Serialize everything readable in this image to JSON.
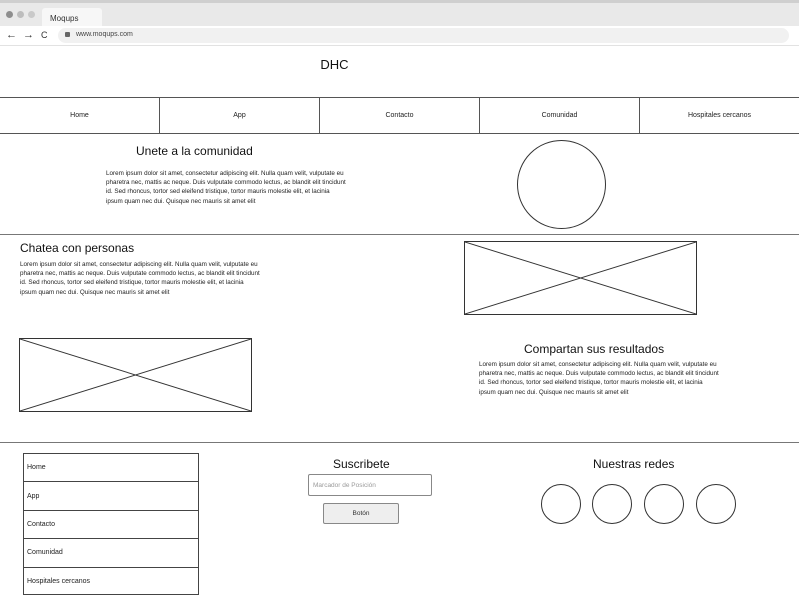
{
  "browser": {
    "tab_title": "Moqups",
    "url": "www.moqups.com",
    "back_icon": "←",
    "forward_icon": "→",
    "reload_icon": "C"
  },
  "site": {
    "title": "DHC"
  },
  "nav": {
    "items": [
      "Home",
      "App",
      "Contacto",
      "Comunidad",
      "Hospitales cercanos"
    ]
  },
  "sections": {
    "community": {
      "heading": "Unete a la comunidad",
      "text": "Lorem ipsum dolor sit amet, consectetur adipiscing elit. Nulla quam velit, vulputate eu pharetra nec, mattis ac neque. Duis vulputate commodo lectus, ac blandit elit tincidunt id. Sed rhoncus, tortor sed eleifend tristique, tortor mauris molestie elit, et lacinia ipsum quam nec dui. Quisque nec mauris sit amet elit"
    },
    "chat": {
      "heading": "Chatea con personas",
      "text": "Lorem ipsum dolor sit amet, consectetur adipiscing elit. Nulla quam velit, vulputate eu pharetra nec, mattis ac neque. Duis vulputate commodo lectus, ac blandit elit tincidunt id. Sed rhoncus, tortor sed eleifend tristique, tortor mauris molestie elit, et lacinia ipsum quam nec dui. Quisque nec mauris sit amet elit"
    },
    "results": {
      "heading": "Compartan sus resultados",
      "text": "Lorem ipsum dolor sit amet, consectetur adipiscing elit. Nulla quam velit, vulputate eu pharetra nec, mattis ac neque. Duis vulputate commodo lectus, ac blandit elit tincidunt id. Sed rhoncus, tortor sed eleifend tristique, tortor mauris molestie elit, et lacinia ipsum quam nec dui. Quisque nec mauris sit amet elit"
    }
  },
  "footer": {
    "nav_items": [
      "Home",
      "App",
      "Contacto",
      "Comunidad",
      "Hospitales cercanos"
    ],
    "subscribe": {
      "heading": "Suscribete",
      "placeholder": "Marcador de Posición",
      "button": "Botón"
    },
    "social": {
      "heading": "Nuestras redes"
    }
  }
}
